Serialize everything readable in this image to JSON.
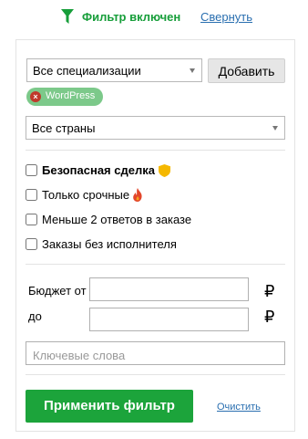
{
  "header": {
    "filter_status": "Фильтр включен",
    "collapse_link": "Свернуть",
    "accent_color": "#179e3a",
    "link_color": "#2a6fb0"
  },
  "specialization": {
    "selected": "Все специализации",
    "add_button": "Добавить",
    "tags": [
      {
        "label": "WordPress",
        "remove_icon": "close-icon"
      }
    ]
  },
  "country": {
    "selected": "Все страны"
  },
  "options": [
    {
      "label": "Безопасная сделка",
      "checked": false,
      "icon": "shield-icon",
      "bold": true
    },
    {
      "label": "Только срочные",
      "checked": false,
      "icon": "fire-icon",
      "bold": false
    },
    {
      "label": "Меньше 2 ответов в заказе",
      "checked": false,
      "icon": "",
      "bold": false
    },
    {
      "label": "Заказы без исполнителя",
      "checked": false,
      "icon": "",
      "bold": false
    }
  ],
  "budget": {
    "from_label": "Бюджет от",
    "to_label": "до",
    "from_value": "",
    "to_value": "",
    "currency": "₽"
  },
  "keywords": {
    "placeholder": "Ключевые слова",
    "value": ""
  },
  "actions": {
    "apply_button": "Применить фильтр",
    "clear_link": "Очистить",
    "apply_color": "#1ca43b"
  }
}
